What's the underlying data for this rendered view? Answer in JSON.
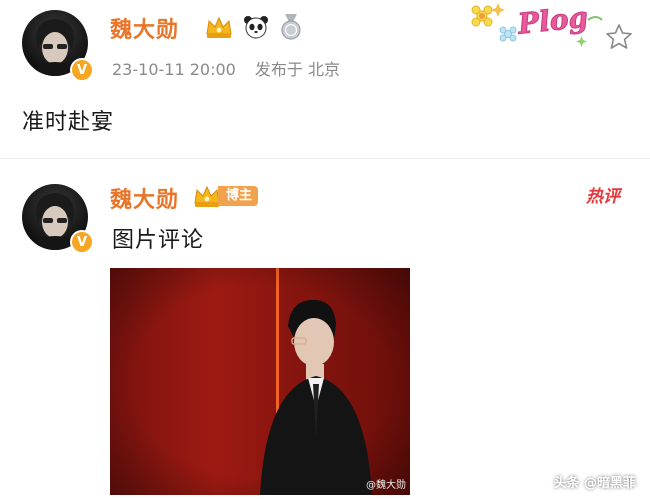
{
  "post": {
    "username": "魏大勋",
    "timestamp": "23-10-11 20:00",
    "location": "发布于 北京",
    "text": "准时赴宴",
    "badges": [
      "crown-badge-icon",
      "panda-badge-icon",
      "medal-badge-icon"
    ],
    "verified": "V",
    "sticker_text": "Plog"
  },
  "comment": {
    "username": "魏大勋",
    "host_label": "博主",
    "text": "图片评论",
    "hot_label": "热评",
    "verified": "V",
    "photo_watermark": "@魏大勋"
  },
  "page_watermark": "头条 @暗黑菲",
  "colors": {
    "username": "#e8752a",
    "hot": "#e4393c",
    "verified": "#f5a623",
    "host_badge": "#f2a14c"
  }
}
